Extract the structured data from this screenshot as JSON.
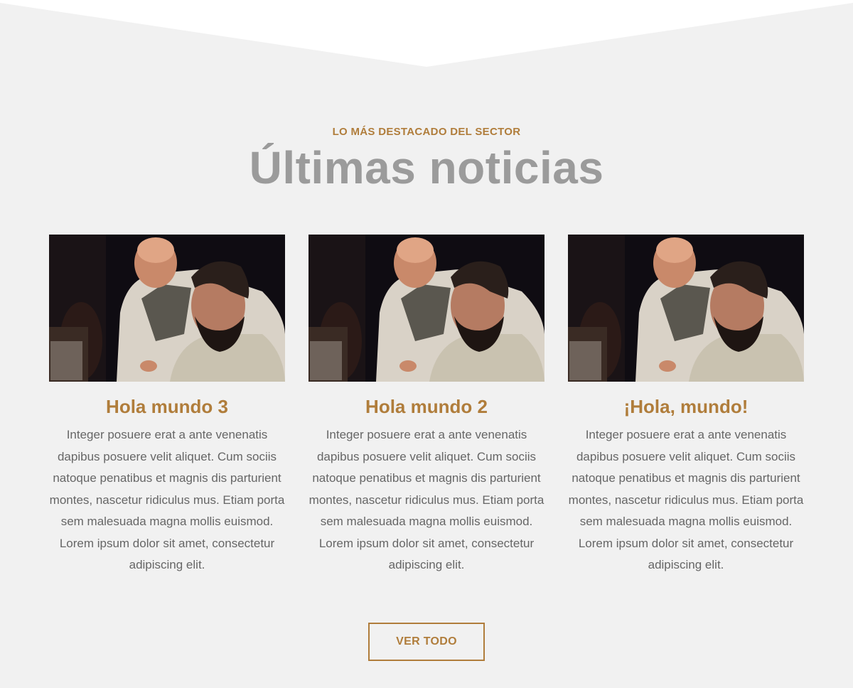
{
  "section": {
    "eyebrow": "LO MÁS DESTACADO DEL SECTOR",
    "title": "Últimas noticias"
  },
  "posts": [
    {
      "title": "Hola mundo 3",
      "excerpt": "Integer posuere erat a ante venenatis dapibus posuere velit aliquet. Cum sociis natoque penatibus et magnis dis parturient montes, nascetur ridiculus mus. Etiam porta sem malesuada magna mollis euismod. Lorem ipsum dolor sit amet, consectetur adipiscing elit."
    },
    {
      "title": "Hola mundo 2",
      "excerpt": "Integer posuere erat a ante venenatis dapibus posuere velit aliquet. Cum sociis natoque penatibus et magnis dis parturient montes, nascetur ridiculus mus. Etiam porta sem malesuada magna mollis euismod. Lorem ipsum dolor sit amet, consectetur adipiscing elit."
    },
    {
      "title": "¡Hola, mundo!",
      "excerpt": "Integer posuere erat a ante venenatis dapibus posuere velit aliquet. Cum sociis natoque penatibus et magnis dis parturient montes, nascetur ridiculus mus. Etiam porta sem malesuada magna mollis euismod. Lorem ipsum dolor sit amet, consectetur adipiscing elit."
    }
  ],
  "button": {
    "label": "VER TODO"
  },
  "colors": {
    "accent": "#b07d3b",
    "background": "#f1f1f1",
    "title_gray": "#9b9b9b",
    "body_text": "#666666"
  }
}
